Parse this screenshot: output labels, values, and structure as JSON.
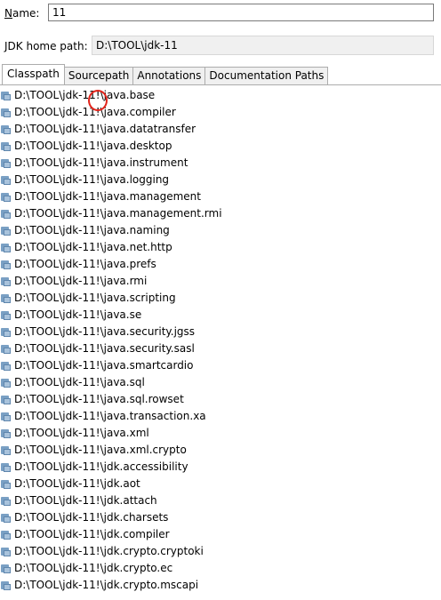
{
  "form": {
    "name_label_mnemonic": "N",
    "name_label_rest": "ame:",
    "name_value": "11",
    "jdk_label": "JDK home path:",
    "jdk_value": "D:\\TOOL\\jdk-11"
  },
  "tabs": [
    {
      "label": "Classpath",
      "active": true
    },
    {
      "label": "Sourcepath",
      "active": false
    },
    {
      "label": "Annotations",
      "active": false
    },
    {
      "label": "Documentation Paths",
      "active": false
    }
  ],
  "classpath_items": [
    "D:\\TOOL\\jdk-11!\\java.base",
    "D:\\TOOL\\jdk-11!\\java.compiler",
    "D:\\TOOL\\jdk-11!\\java.datatransfer",
    "D:\\TOOL\\jdk-11!\\java.desktop",
    "D:\\TOOL\\jdk-11!\\java.instrument",
    "D:\\TOOL\\jdk-11!\\java.logging",
    "D:\\TOOL\\jdk-11!\\java.management",
    "D:\\TOOL\\jdk-11!\\java.management.rmi",
    "D:\\TOOL\\jdk-11!\\java.naming",
    "D:\\TOOL\\jdk-11!\\java.net.http",
    "D:\\TOOL\\jdk-11!\\java.prefs",
    "D:\\TOOL\\jdk-11!\\java.rmi",
    "D:\\TOOL\\jdk-11!\\java.scripting",
    "D:\\TOOL\\jdk-11!\\java.se",
    "D:\\TOOL\\jdk-11!\\java.security.jgss",
    "D:\\TOOL\\jdk-11!\\java.security.sasl",
    "D:\\TOOL\\jdk-11!\\java.smartcardio",
    "D:\\TOOL\\jdk-11!\\java.sql",
    "D:\\TOOL\\jdk-11!\\java.sql.rowset",
    "D:\\TOOL\\jdk-11!\\java.transaction.xa",
    "D:\\TOOL\\jdk-11!\\java.xml",
    "D:\\TOOL\\jdk-11!\\java.xml.crypto",
    "D:\\TOOL\\jdk-11!\\jdk.accessibility",
    "D:\\TOOL\\jdk-11!\\jdk.aot",
    "D:\\TOOL\\jdk-11!\\jdk.attach",
    "D:\\TOOL\\jdk-11!\\jdk.charsets",
    "D:\\TOOL\\jdk-11!\\jdk.compiler",
    "D:\\TOOL\\jdk-11!\\jdk.crypto.cryptoki",
    "D:\\TOOL\\jdk-11!\\jdk.crypto.ec",
    "D:\\TOOL\\jdk-11!\\jdk.crypto.mscapi"
  ],
  "icons": {
    "item_icon": "jar-archive-icon"
  },
  "colors": {
    "annotation_circle": "#e2231a"
  }
}
